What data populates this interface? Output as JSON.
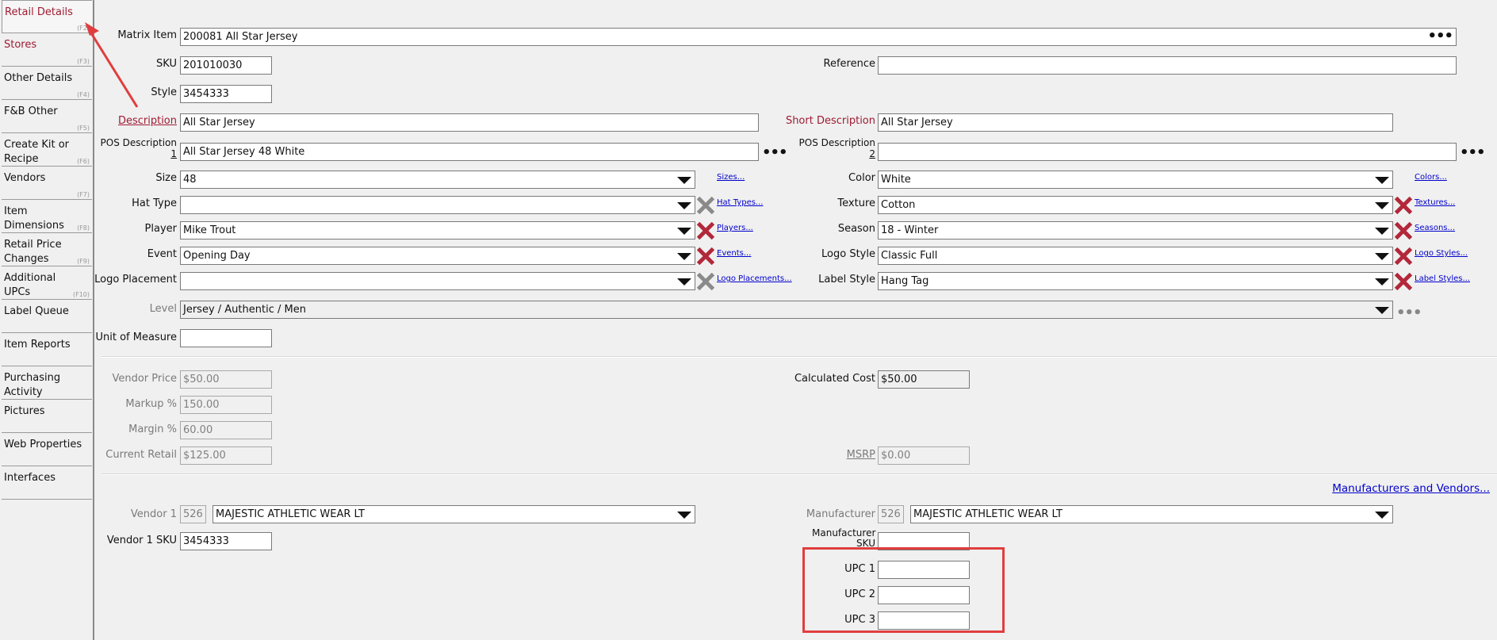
{
  "sidebar": {
    "items": [
      {
        "label": "Retail Details",
        "key": "(F2)"
      },
      {
        "label": "Stores",
        "key": "(F3)"
      },
      {
        "label": "Other Details",
        "key": "(F4)"
      },
      {
        "label": "F&B Other",
        "key": "(F5)"
      },
      {
        "label": "Create Kit or Recipe",
        "key": "(F6)"
      },
      {
        "label": "Vendors",
        "key": "(F7)"
      },
      {
        "label": "Item Dimensions",
        "key": "(F8)"
      },
      {
        "label": "Retail Price Changes",
        "key": "(F9)"
      },
      {
        "label": "Additional UPCs",
        "key": "(F10)"
      },
      {
        "label": "Label Queue",
        "key": ""
      },
      {
        "label": "Item Reports",
        "key": ""
      },
      {
        "label": "Purchasing Activity",
        "key": ""
      },
      {
        "label": "Pictures",
        "key": ""
      },
      {
        "label": "Web Properties",
        "key": ""
      },
      {
        "label": "Interfaces",
        "key": ""
      }
    ]
  },
  "form": {
    "matrix_item": {
      "label": "Matrix Item",
      "value": "200081 All Star Jersey"
    },
    "sku": {
      "label": "SKU",
      "value": "201010030"
    },
    "reference": {
      "label": "Reference",
      "value": ""
    },
    "style": {
      "label": "Style",
      "value": "3454333"
    },
    "description": {
      "label": "Description",
      "value": "All Star Jersey"
    },
    "short_description": {
      "label": "Short Description",
      "value": "All Star Jersey"
    },
    "pos_description_1": {
      "label": "POS Description",
      "num": "1",
      "value": "All Star Jersey 48 White"
    },
    "pos_description_2": {
      "label": "POS Description",
      "num": "2",
      "value": ""
    },
    "size": {
      "label": "Size",
      "value": "48",
      "link": "Sizes..."
    },
    "color": {
      "label": "Color",
      "value": "White",
      "link": "Colors..."
    },
    "hat_type": {
      "label": "Hat Type",
      "value": "",
      "link": "Hat Types..."
    },
    "texture": {
      "label": "Texture",
      "value": "Cotton",
      "link": "Textures..."
    },
    "player": {
      "label": "Player",
      "value": "Mike Trout",
      "link": "Players..."
    },
    "season": {
      "label": "Season",
      "value": "18 - Winter",
      "link": "Seasons..."
    },
    "event": {
      "label": "Event",
      "value": "Opening Day",
      "link": "Events..."
    },
    "logo_style": {
      "label": "Logo Style",
      "value": "Classic Full",
      "link": "Logo Styles..."
    },
    "logo_placement": {
      "label": "Logo Placement",
      "value": "",
      "link": "Logo Placements..."
    },
    "label_style": {
      "label": "Label Style",
      "value": "Hang Tag",
      "link": "Label Styles..."
    },
    "level": {
      "label": "Level",
      "value": "Jersey / Authentic / Men"
    },
    "unit_of_measure": {
      "label": "Unit of Measure",
      "value": ""
    },
    "vendor_price": {
      "label": "Vendor Price",
      "value": "$50.00"
    },
    "calculated_cost": {
      "label": "Calculated Cost",
      "value": "$50.00"
    },
    "markup": {
      "label": "Markup %",
      "value": "150.00"
    },
    "margin": {
      "label": "Margin %",
      "value": "60.00"
    },
    "current_retail": {
      "label": "Current Retail",
      "value": "$125.00"
    },
    "msrp": {
      "label": "MSRP",
      "value": "$0.00"
    },
    "manufacturers_vendors_link": "Manufacturers and Vendors...",
    "vendor1": {
      "label": "Vendor 1",
      "code": "526",
      "value": "MAJESTIC ATHLETIC WEAR LT"
    },
    "manufacturer": {
      "label": "Manufacturer",
      "code": "526",
      "value": "MAJESTIC ATHLETIC WEAR LT"
    },
    "vendor1_sku": {
      "label": "Vendor 1 SKU",
      "value": "3454333"
    },
    "manufacturer_sku": {
      "label": "Manufacturer SKU",
      "value": ""
    },
    "upc1": {
      "label": "UPC 1",
      "value": ""
    },
    "upc2": {
      "label": "UPC 2",
      "value": ""
    },
    "upc3": {
      "label": "UPC 3",
      "value": ""
    }
  },
  "icons": {
    "ellipsis": "ellipsis-icon",
    "clear": "clear-x-icon",
    "dropdown": "chevron-down-icon"
  },
  "colors": {
    "label_red": "#9e1b32",
    "annotation_red": "#e03e3e",
    "clear_red": "#b2283a",
    "clear_grey": "#8a8a8a",
    "link_blue": "#0000cc"
  }
}
